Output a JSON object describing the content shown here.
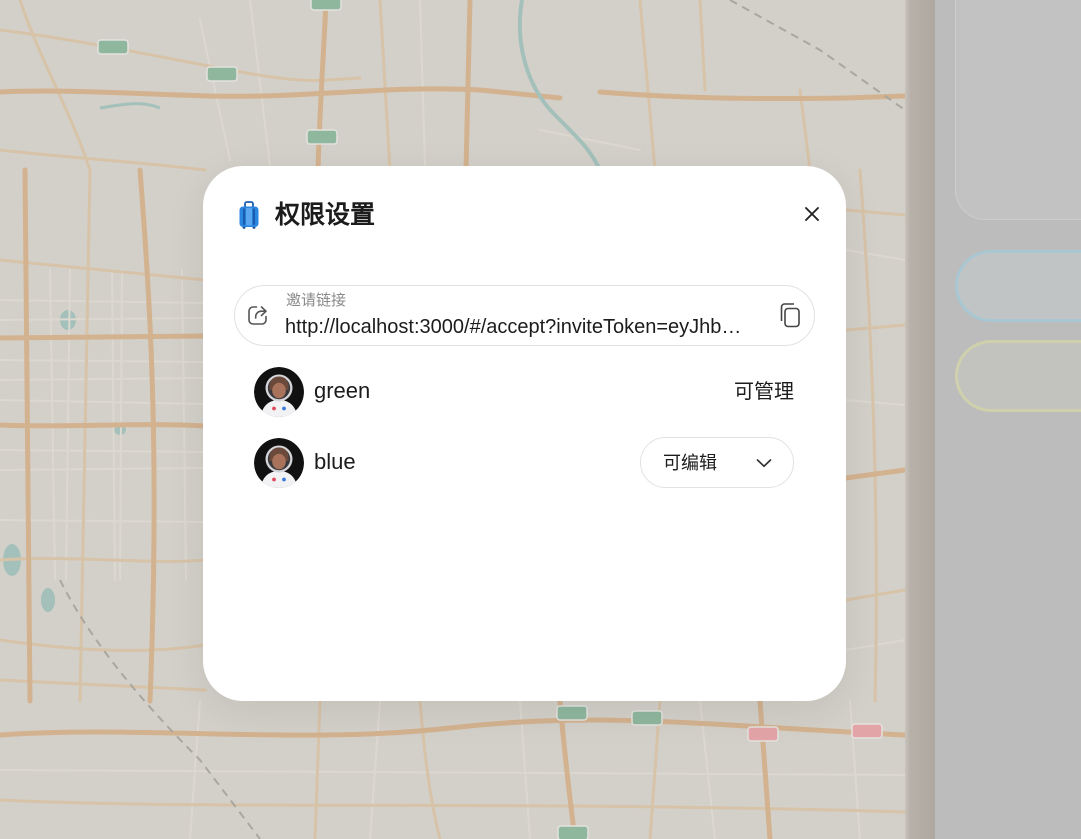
{
  "dialog": {
    "title": "权限设置",
    "title_icon": "suitcase-icon",
    "close_icon": "close-icon",
    "invite": {
      "label": "邀请链接",
      "url": "http://localhost:3000/#/accept?inviteToken=eyJhb…",
      "share_icon": "share-icon",
      "copy_icon": "copy-icon"
    },
    "members": [
      {
        "name": "green",
        "permission": "可管理",
        "avatar": "astronaut-avatar",
        "has_dropdown": false
      },
      {
        "name": "blue",
        "permission": "可编辑",
        "avatar": "astronaut-avatar",
        "has_dropdown": true,
        "dropdown_icon": "chevron-down-icon"
      }
    ]
  },
  "colors": {
    "dialog_background": "#ffffff",
    "text_primary": "#1c1c1c",
    "text_secondary": "#8a8a8a",
    "border": "#e2e2e2",
    "suitcase_blue": "#2b86e0",
    "sidebar_blue_outline": "#a9c7d2",
    "sidebar_yellow_outline": "#cfd1ac",
    "map_road": "#d3b28f",
    "map_water": "#a4c0bb"
  }
}
